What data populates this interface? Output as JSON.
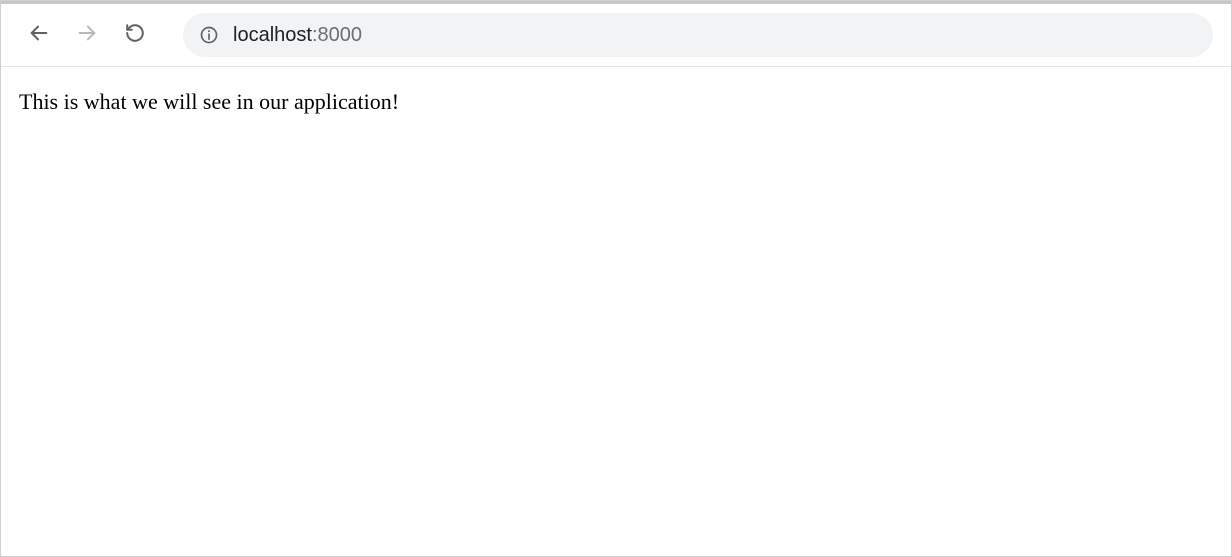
{
  "browser": {
    "url_host": "localhost",
    "url_port": ":8000"
  },
  "page": {
    "body_text": "This is what we will see in our application!"
  }
}
